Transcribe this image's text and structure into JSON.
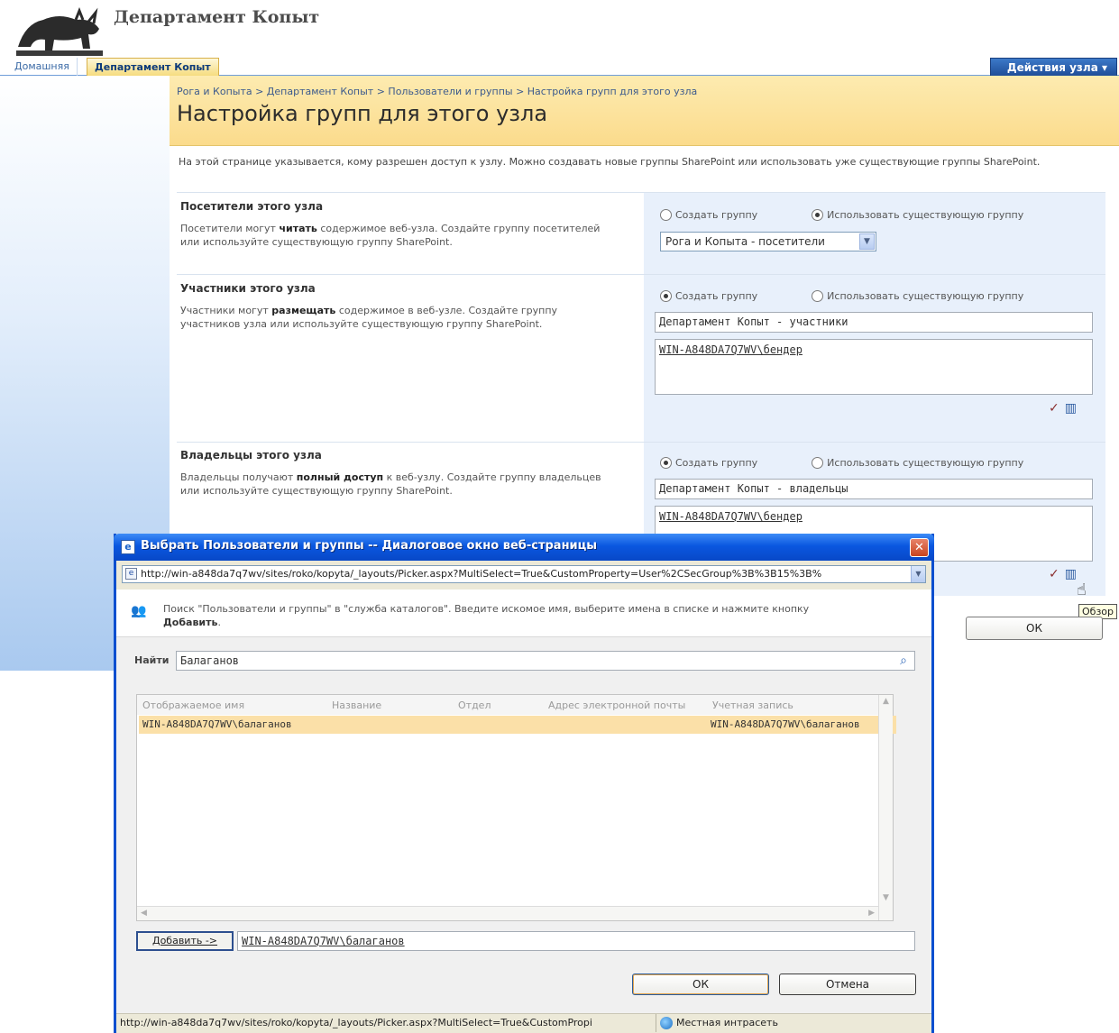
{
  "site": {
    "title": "Департамент Копыт"
  },
  "topnav": {
    "home": "Домашняя",
    "current": "Департамент Копыт",
    "actions": "Действия узла ▾"
  },
  "page": {
    "breadcrumb": "Рога и Копыта > Департамент Копыт > Пользователи и группы > Настройка групп для этого узла",
    "title": "Настройка групп для этого узла",
    "intro": "На этой странице указывается, кому разрешен доступ к узлу. Можно создавать новые группы SharePoint или использовать уже существующие группы SharePoint."
  },
  "sections": {
    "visitors": {
      "title": "Посетители этого узла",
      "desc_before": "Посетители могут ",
      "desc_bold": "читать",
      "desc_after": " содержимое веб-узла. Создайте группу посетителей или используйте существующую группу SharePoint.",
      "opt_create": "Создать группу",
      "opt_use": "Использовать существующую группу",
      "selected_group": "Рога и Копыта - посетители"
    },
    "members": {
      "title": "Участники этого узла",
      "desc_before": "Участники могут ",
      "desc_bold": "размещать",
      "desc_after": " содержимое в веб-узле. Создайте группу участников узла или используйте существующую группу SharePoint.",
      "opt_create": "Создать группу",
      "opt_use": "Использовать существующую группу",
      "group_name": "Департамент Копыт - участники",
      "people": "WIN-A848DA7Q7WV\\бендер"
    },
    "owners": {
      "title": "Владельцы этого узла",
      "desc_before": "Владельцы получают ",
      "desc_bold": "полный доступ",
      "desc_after": " к веб-узлу. Создайте группу владельцев или используйте существующую группу SharePoint.",
      "opt_create": "Создать группу",
      "opt_use": "Использовать существующую группу",
      "group_name": "Департамент Копыт - владельцы",
      "people": "WIN-A848DA7Q7WV\\бендер"
    }
  },
  "ok_label": "ОК",
  "tooltip": "Обзор",
  "dialog": {
    "title": "Выбрать Пользователи и группы -- Диалоговое окно веб-страницы",
    "address": "http://win-a848da7q7wv/sites/roko/kopyta/_layouts/Picker.aspx?MultiSelect=True&CustomProperty=User%2CSecGroup%3B%3B15%3B%",
    "info_text": "Поиск \"Пользователи и группы\" в \"служба каталогов\". Введите искомое имя, выберите имена в списке и нажмите кнопку",
    "info_bold": "Добавить",
    "find_label": "Найти",
    "find_value": "Балаганов",
    "columns": [
      "Отображаемое имя",
      "Название",
      "Отдел",
      "Адрес электронной почты",
      "Учетная запись"
    ],
    "result": {
      "display_name": "WIN-A848DA7Q7WV\\балаганов",
      "account": "WIN-A848DA7Q7WV\\балаганов"
    },
    "add_label": "Добавить ->",
    "added_value": "WIN-A848DA7Q7WV\\балаганов",
    "ok_label": "ОК",
    "cancel_label": "Отмена",
    "status_url": "http://win-a848da7q7wv/sites/roko/kopyta/_layouts/Picker.aspx?MultiSelect=True&CustomPropi",
    "status_zone": "Местная интрасеть"
  }
}
